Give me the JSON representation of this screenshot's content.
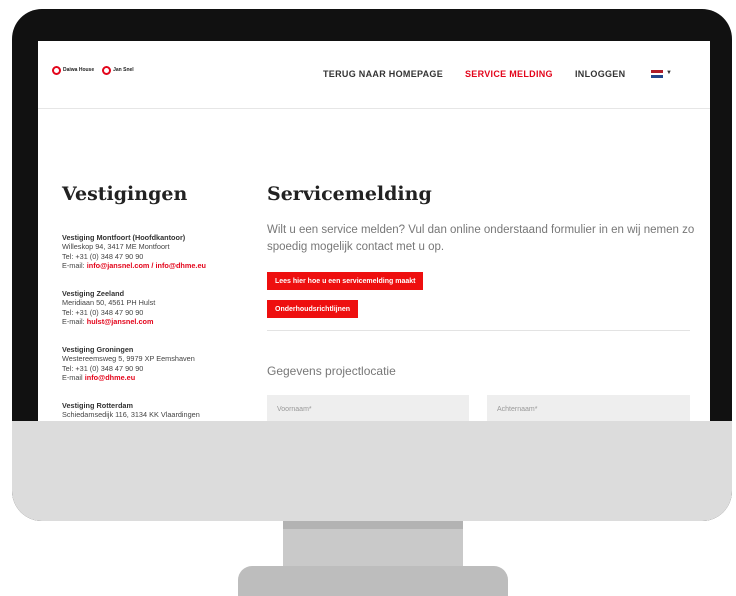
{
  "header": {
    "logo_daiwa": "Daiwa House",
    "logo_jansnel": "Jan Snel",
    "nav": [
      {
        "label": "TERUG NAAR HOMEPAGE",
        "active": false
      },
      {
        "label": "SERVICE MELDING",
        "active": true
      },
      {
        "label": "INLOGGEN",
        "active": false
      }
    ],
    "flag_colors": [
      "#ae1c28",
      "#ffffff",
      "#21468b"
    ]
  },
  "sidebar": {
    "title": "Vestigingen",
    "locations": [
      {
        "name": "Vestiging Montfoort (Hoofdkantoor)",
        "address": "Willeskop 94, 3417 ME Montfoort",
        "phone": "Tel: +31 (0) 348 47 90 90",
        "email_prefix": "E-mail: ",
        "email": "info@jansnel.com / info@dhme.eu"
      },
      {
        "name": "Vestiging Zeeland",
        "address": "Meridiaan 50, 4561 PH Hulst",
        "phone": "Tel: +31 (0) 348 47 90 90",
        "email_prefix": "E-mail: ",
        "email": "hulst@jansnel.com"
      },
      {
        "name": "Vestiging Groningen",
        "address": "Westereemsweg 5, 9979 XP Eemshaven",
        "phone": "Tel: +31 (0) 348 47 90 90",
        "email_prefix": "E-mail ",
        "email": "info@dhme.eu"
      },
      {
        "name": "Vestiging Rotterdam",
        "address": "Schiedamsedijk 116, 3134 KK Vlaardingen"
      }
    ]
  },
  "main": {
    "title": "Servicemelding",
    "intro": "Wilt u een service melden? Vul dan online onderstaand formulier in en wij nemen zo spoedig mogelijk contact met u op.",
    "button_howto": "Lees hier hoe u een servicemelding maakt",
    "button_maintenance": "Onderhoudsrichtlijnen",
    "section_title": "Gegevens projectlocatie",
    "firstname_placeholder": "Voornaam*",
    "lastname_placeholder": "Achternaam*"
  },
  "colors": {
    "accent": "#e3051b",
    "button": "#ee0f0f"
  }
}
